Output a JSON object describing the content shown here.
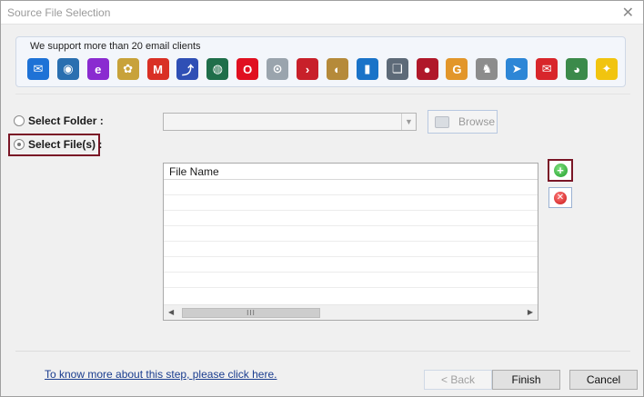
{
  "window": {
    "title": "Source File Selection",
    "close_glyph": "✕"
  },
  "clients": {
    "label": "We support more than 20 email clients",
    "icons": [
      {
        "name": "mail-icon",
        "glyph": "✉",
        "color": "#1e72d6"
      },
      {
        "name": "thunderbird-icon",
        "glyph": "◉",
        "color": "#2a6fb0"
      },
      {
        "name": "entourage-icon",
        "glyph": "e",
        "color": "#8a2bd0"
      },
      {
        "name": "pegasus-icon",
        "glyph": "✿",
        "color": "#c8a23a"
      },
      {
        "name": "gmail-icon",
        "glyph": "M",
        "color": "#d93025"
      },
      {
        "name": "netscape-icon",
        "glyph": "⤴",
        "color": "#2f4fb5"
      },
      {
        "name": "seamonkey-icon",
        "glyph": "◍",
        "color": "#1f6e4a"
      },
      {
        "name": "opera-icon",
        "glyph": "O",
        "color": "#e01020"
      },
      {
        "name": "mailbox-icon",
        "glyph": "⊙",
        "color": "#9aa4ad"
      },
      {
        "name": "arrow-icon",
        "glyph": "›",
        "color": "#c8202a"
      },
      {
        "name": "eudora-icon",
        "glyph": "◐",
        "color": "#b58a3a"
      },
      {
        "name": "outlook-icon",
        "glyph": "▮",
        "color": "#1a73c8"
      },
      {
        "name": "notes-icon",
        "glyph": "❏",
        "color": "#5d6a78"
      },
      {
        "name": "grapes-icon",
        "glyph": "●",
        "color": "#b0182a"
      },
      {
        "name": "g-icon",
        "glyph": "G",
        "color": "#e2962a"
      },
      {
        "name": "gnu-icon",
        "glyph": "♞",
        "color": "#8c8c8c"
      },
      {
        "name": "send-icon",
        "glyph": "➤",
        "color": "#2d86d6"
      },
      {
        "name": "envelope-red-icon",
        "glyph": "✉",
        "color": "#d8262b"
      },
      {
        "name": "sylpheed-icon",
        "glyph": "◕",
        "color": "#3b8a4a"
      },
      {
        "name": "bat-icon",
        "glyph": "✦",
        "color": "#f1c40f"
      }
    ]
  },
  "options": {
    "select_folder": "Select Folder :",
    "select_files": "Select File(s) :",
    "selected": "files"
  },
  "folder": {
    "value": "",
    "browse_label": "Browse"
  },
  "filelist": {
    "header": "File Name",
    "rows": [],
    "scroll_grip": "III"
  },
  "footer": {
    "help_link": "To know more about this step, please click here.",
    "back_label": "< Back",
    "finish_label": "Finish",
    "cancel_label": "Cancel"
  }
}
